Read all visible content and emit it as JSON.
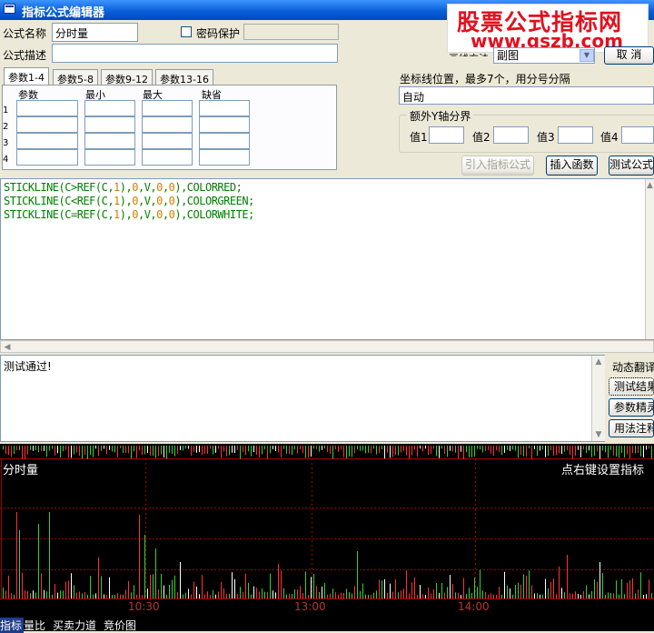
{
  "window": {
    "title": "指标公式编辑器"
  },
  "watermark": {
    "line1": "股票公式指标网",
    "line2": "www.gszb.com"
  },
  "form": {
    "name_label": "公式名称",
    "name_value": "分时量",
    "password_label": "密码保护",
    "desc_label": "公式描述",
    "desc_value": "",
    "draw_method_label": "画线方法",
    "draw_method_value": "副图",
    "cancel_label": "取 消"
  },
  "params": {
    "tabs": [
      "参数1-4",
      "参数5-8",
      "参数9-12",
      "参数13-16"
    ],
    "headers": [
      "参数",
      "最小",
      "最大",
      "缺省"
    ],
    "rows": [
      "1",
      "2",
      "3",
      "4"
    ]
  },
  "axis": {
    "label": "坐标线位置，最多7个，用分号分隔",
    "value": "自动",
    "extra_y_label": "额外Y轴分界",
    "val_labels": [
      "值1",
      "值2",
      "值3",
      "值4"
    ]
  },
  "buttons": {
    "import": "引入指标公式",
    "insert_func": "插入函数",
    "test": "测试公式"
  },
  "code_lines": [
    {
      "color": "#008000",
      "tokens": [
        {
          "t": "STICKLINE(C>REF(C,",
          "c": "#008000"
        },
        {
          "t": "1",
          "c": "#D08000"
        },
        {
          "t": "),",
          "c": "#008000"
        },
        {
          "t": "0",
          "c": "#D08000"
        },
        {
          "t": ",V,",
          "c": "#008000"
        },
        {
          "t": "0",
          "c": "#D08000"
        },
        {
          "t": ",",
          "c": "#008000"
        },
        {
          "t": "0",
          "c": "#D08000"
        },
        {
          "t": "),COLORRED;",
          "c": "#008000"
        }
      ]
    },
    {
      "color": "#008000",
      "tokens": [
        {
          "t": "STICKLINE(C<REF(C,",
          "c": "#008000"
        },
        {
          "t": "1",
          "c": "#D08000"
        },
        {
          "t": "),",
          "c": "#008000"
        },
        {
          "t": "0",
          "c": "#D08000"
        },
        {
          "t": ",V,",
          "c": "#008000"
        },
        {
          "t": "0",
          "c": "#D08000"
        },
        {
          "t": ",",
          "c": "#008000"
        },
        {
          "t": "0",
          "c": "#D08000"
        },
        {
          "t": "),COLORGREEN;",
          "c": "#008000"
        }
      ]
    },
    {
      "color": "#008000",
      "tokens": [
        {
          "t": "STICKLINE(C=REF(C,",
          "c": "#008000"
        },
        {
          "t": "1",
          "c": "#D08000"
        },
        {
          "t": "),",
          "c": "#008000"
        },
        {
          "t": "0",
          "c": "#D08000"
        },
        {
          "t": ",V,",
          "c": "#008000"
        },
        {
          "t": "0",
          "c": "#D08000"
        },
        {
          "t": ",",
          "c": "#008000"
        },
        {
          "t": "0",
          "c": "#D08000"
        },
        {
          "t": "),COLORWHITE;",
          "c": "#008000"
        }
      ]
    }
  ],
  "result": {
    "text": "测试通过!"
  },
  "side_buttons": [
    "动态翻译",
    "测试结果",
    "参数精灵",
    "用法注释"
  ],
  "chart": {
    "title": "分时量",
    "hint": "点右键设置指标",
    "time_labels": [
      "10:30",
      "13:00",
      "14:00"
    ],
    "colors": {
      "up": "#FF3232",
      "down": "#32D232",
      "flat": "#FFFFFF",
      "grid": "#A00000",
      "time": "#C03030"
    }
  },
  "bottom_tabs": [
    "指标",
    "量比",
    "买卖力道",
    "竞价图"
  ]
}
